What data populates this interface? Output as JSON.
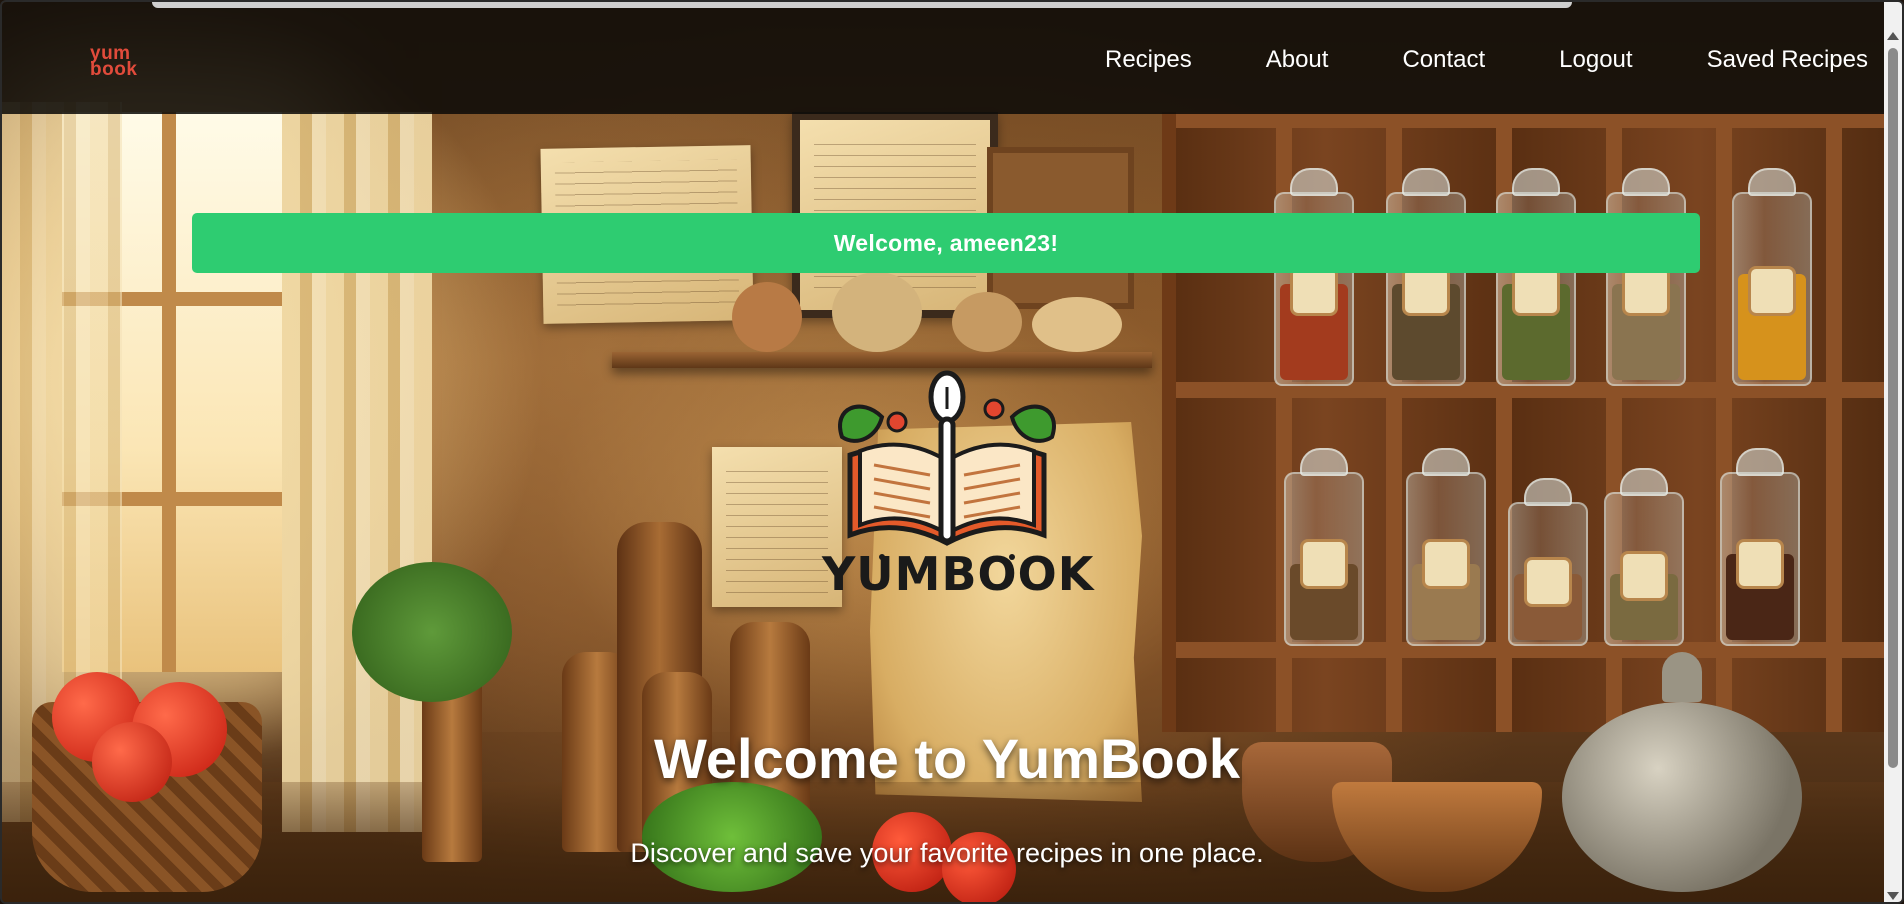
{
  "brand": {
    "line1": "yum",
    "line2": "book"
  },
  "nav": {
    "items": [
      {
        "label": "Recipes"
      },
      {
        "label": "About"
      },
      {
        "label": "Contact"
      },
      {
        "label": "Logout"
      },
      {
        "label": "Saved Recipes"
      }
    ]
  },
  "alert": {
    "message": "Welcome, ameen23!",
    "color": "#2ecc71"
  },
  "logo": {
    "wordmark": "YUMBOOK",
    "icon": "open-book-spoon-icon"
  },
  "hero": {
    "title": "Welcome to YumBook",
    "subtitle": "Discover and save your favorite recipes in one place."
  },
  "colors": {
    "brand_red": "#e14b3b",
    "navbar_bg": "#0c0a08"
  }
}
